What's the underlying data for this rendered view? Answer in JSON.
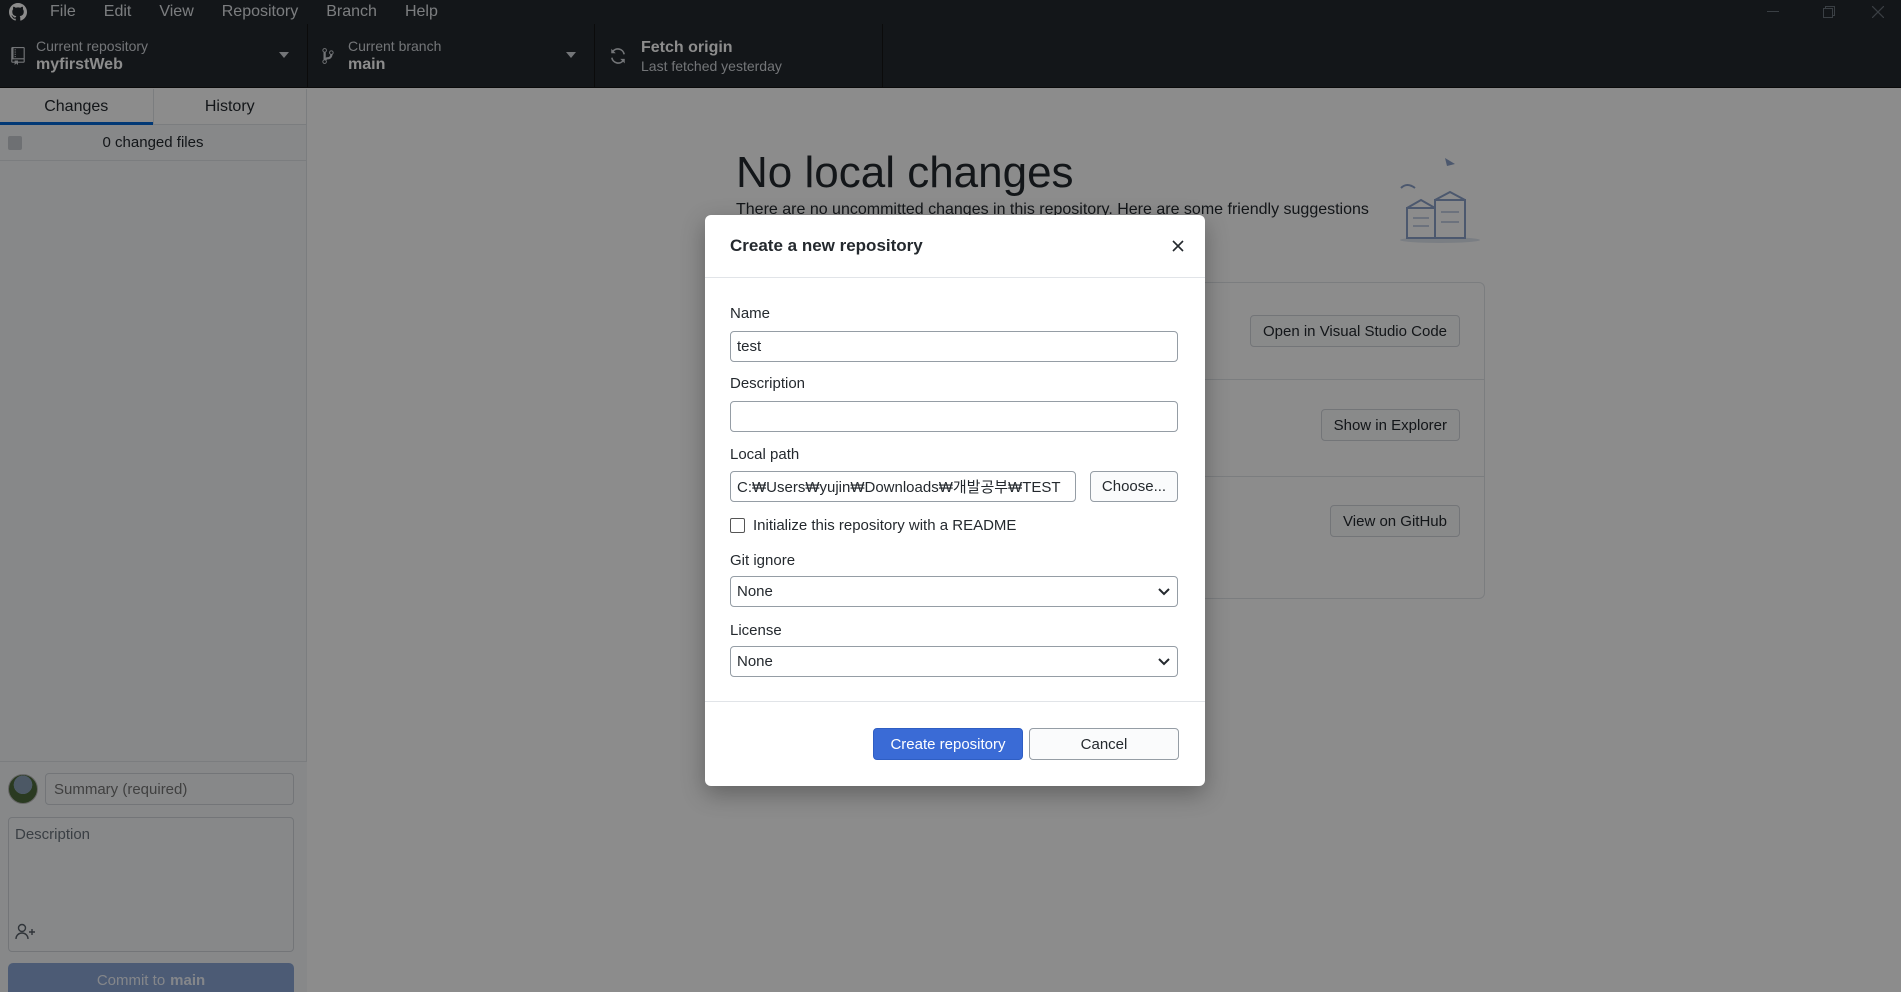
{
  "menu": {
    "items": [
      "File",
      "Edit",
      "View",
      "Repository",
      "Branch",
      "Help"
    ]
  },
  "toolbar": {
    "repository": {
      "label": "Current repository",
      "value": "myfirstWeb"
    },
    "branch": {
      "label": "Current branch",
      "value": "main"
    },
    "fetch": {
      "label": "Fetch origin",
      "sub": "Last fetched yesterday"
    }
  },
  "sidebar": {
    "tabs": [
      {
        "label": "Changes",
        "active": true
      },
      {
        "label": "History",
        "active": false
      }
    ],
    "changed_files": "0 changed files",
    "commit": {
      "summary_placeholder": "Summary (required)",
      "description_placeholder": "Description",
      "button_prefix": "Commit to",
      "button_branch": "main"
    }
  },
  "main": {
    "title": "No local changes",
    "subtitle": "There are no uncommitted changes in this repository. Here are some friendly suggestions",
    "suggestions": [
      {
        "button": "Open in Visual Studio Code"
      },
      {
        "button": "Show in Explorer"
      },
      {
        "button": "View on GitHub"
      }
    ]
  },
  "dialog": {
    "title": "Create a new repository",
    "name": {
      "label": "Name",
      "value": "test"
    },
    "description": {
      "label": "Description",
      "value": ""
    },
    "local_path": {
      "label": "Local path",
      "value": "C:₩Users₩yujin₩Downloads₩개발공부₩TEST",
      "choose_label": "Choose..."
    },
    "readme": {
      "label": "Initialize this repository with a README",
      "checked": false
    },
    "git_ignore": {
      "label": "Git ignore",
      "selected": "None"
    },
    "license": {
      "label": "License",
      "selected": "None"
    },
    "create_label": "Create repository",
    "cancel_label": "Cancel"
  },
  "colors": {
    "chrome_dark": "#24292e",
    "accent_blue": "#0366d6",
    "primary_button": "#3a6bd6"
  },
  "icons": [
    "github-logo-icon",
    "repo-icon",
    "branch-icon",
    "sync-icon",
    "caret-down-icon",
    "close-icon",
    "chevron-down-icon",
    "add-coauthor-icon"
  ]
}
